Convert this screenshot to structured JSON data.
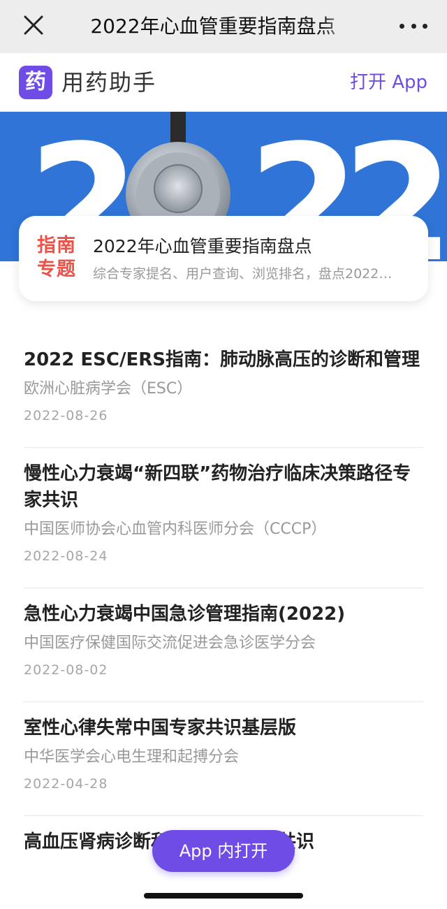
{
  "navbar": {
    "title": "2022年心血管重要指南盘点",
    "close_icon": "close-icon",
    "more_icon": "more-dots-icon"
  },
  "app_banner": {
    "logo_char": "药",
    "app_name": "用药助手",
    "open_label": "打开 App",
    "accent": "#6f4ce6"
  },
  "hero": {
    "year_digits": [
      "2",
      "0",
      "2",
      "2"
    ],
    "background": "#2f74d6"
  },
  "topic": {
    "tag": "指南专题",
    "tag_color": "#e8534a",
    "title": "2022年心血管重要指南盘点",
    "description": "综合专家提名、用户查询、浏览排名，盘点2022…"
  },
  "items": [
    {
      "title": "2022 ESC/ERS指南：肺动脉高压的诊断和管理",
      "org": "欧洲心脏病学会（ESC）",
      "date": "2022-08-26"
    },
    {
      "title": "慢性心力衰竭“新四联”药物治疗临床决策路径专家共识",
      "org": "中国医师协会心血管内科医师分会（CCCP）",
      "date": "2022-08-24"
    },
    {
      "title": "急性心力衰竭中国急诊管理指南(2022)",
      "org": "中国医疗保健国际交流促进会急诊医学分会",
      "date": "2022-08-02"
    },
    {
      "title": "室性心律失常中国专家共识基层版",
      "org": "中华医学会心电生理和起搏分会",
      "date": "2022-04-28"
    },
    {
      "title": "高血压肾病诊断和治疗中国专家共识",
      "org": "",
      "date": ""
    }
  ],
  "float_button": {
    "label": "App 内打开"
  }
}
